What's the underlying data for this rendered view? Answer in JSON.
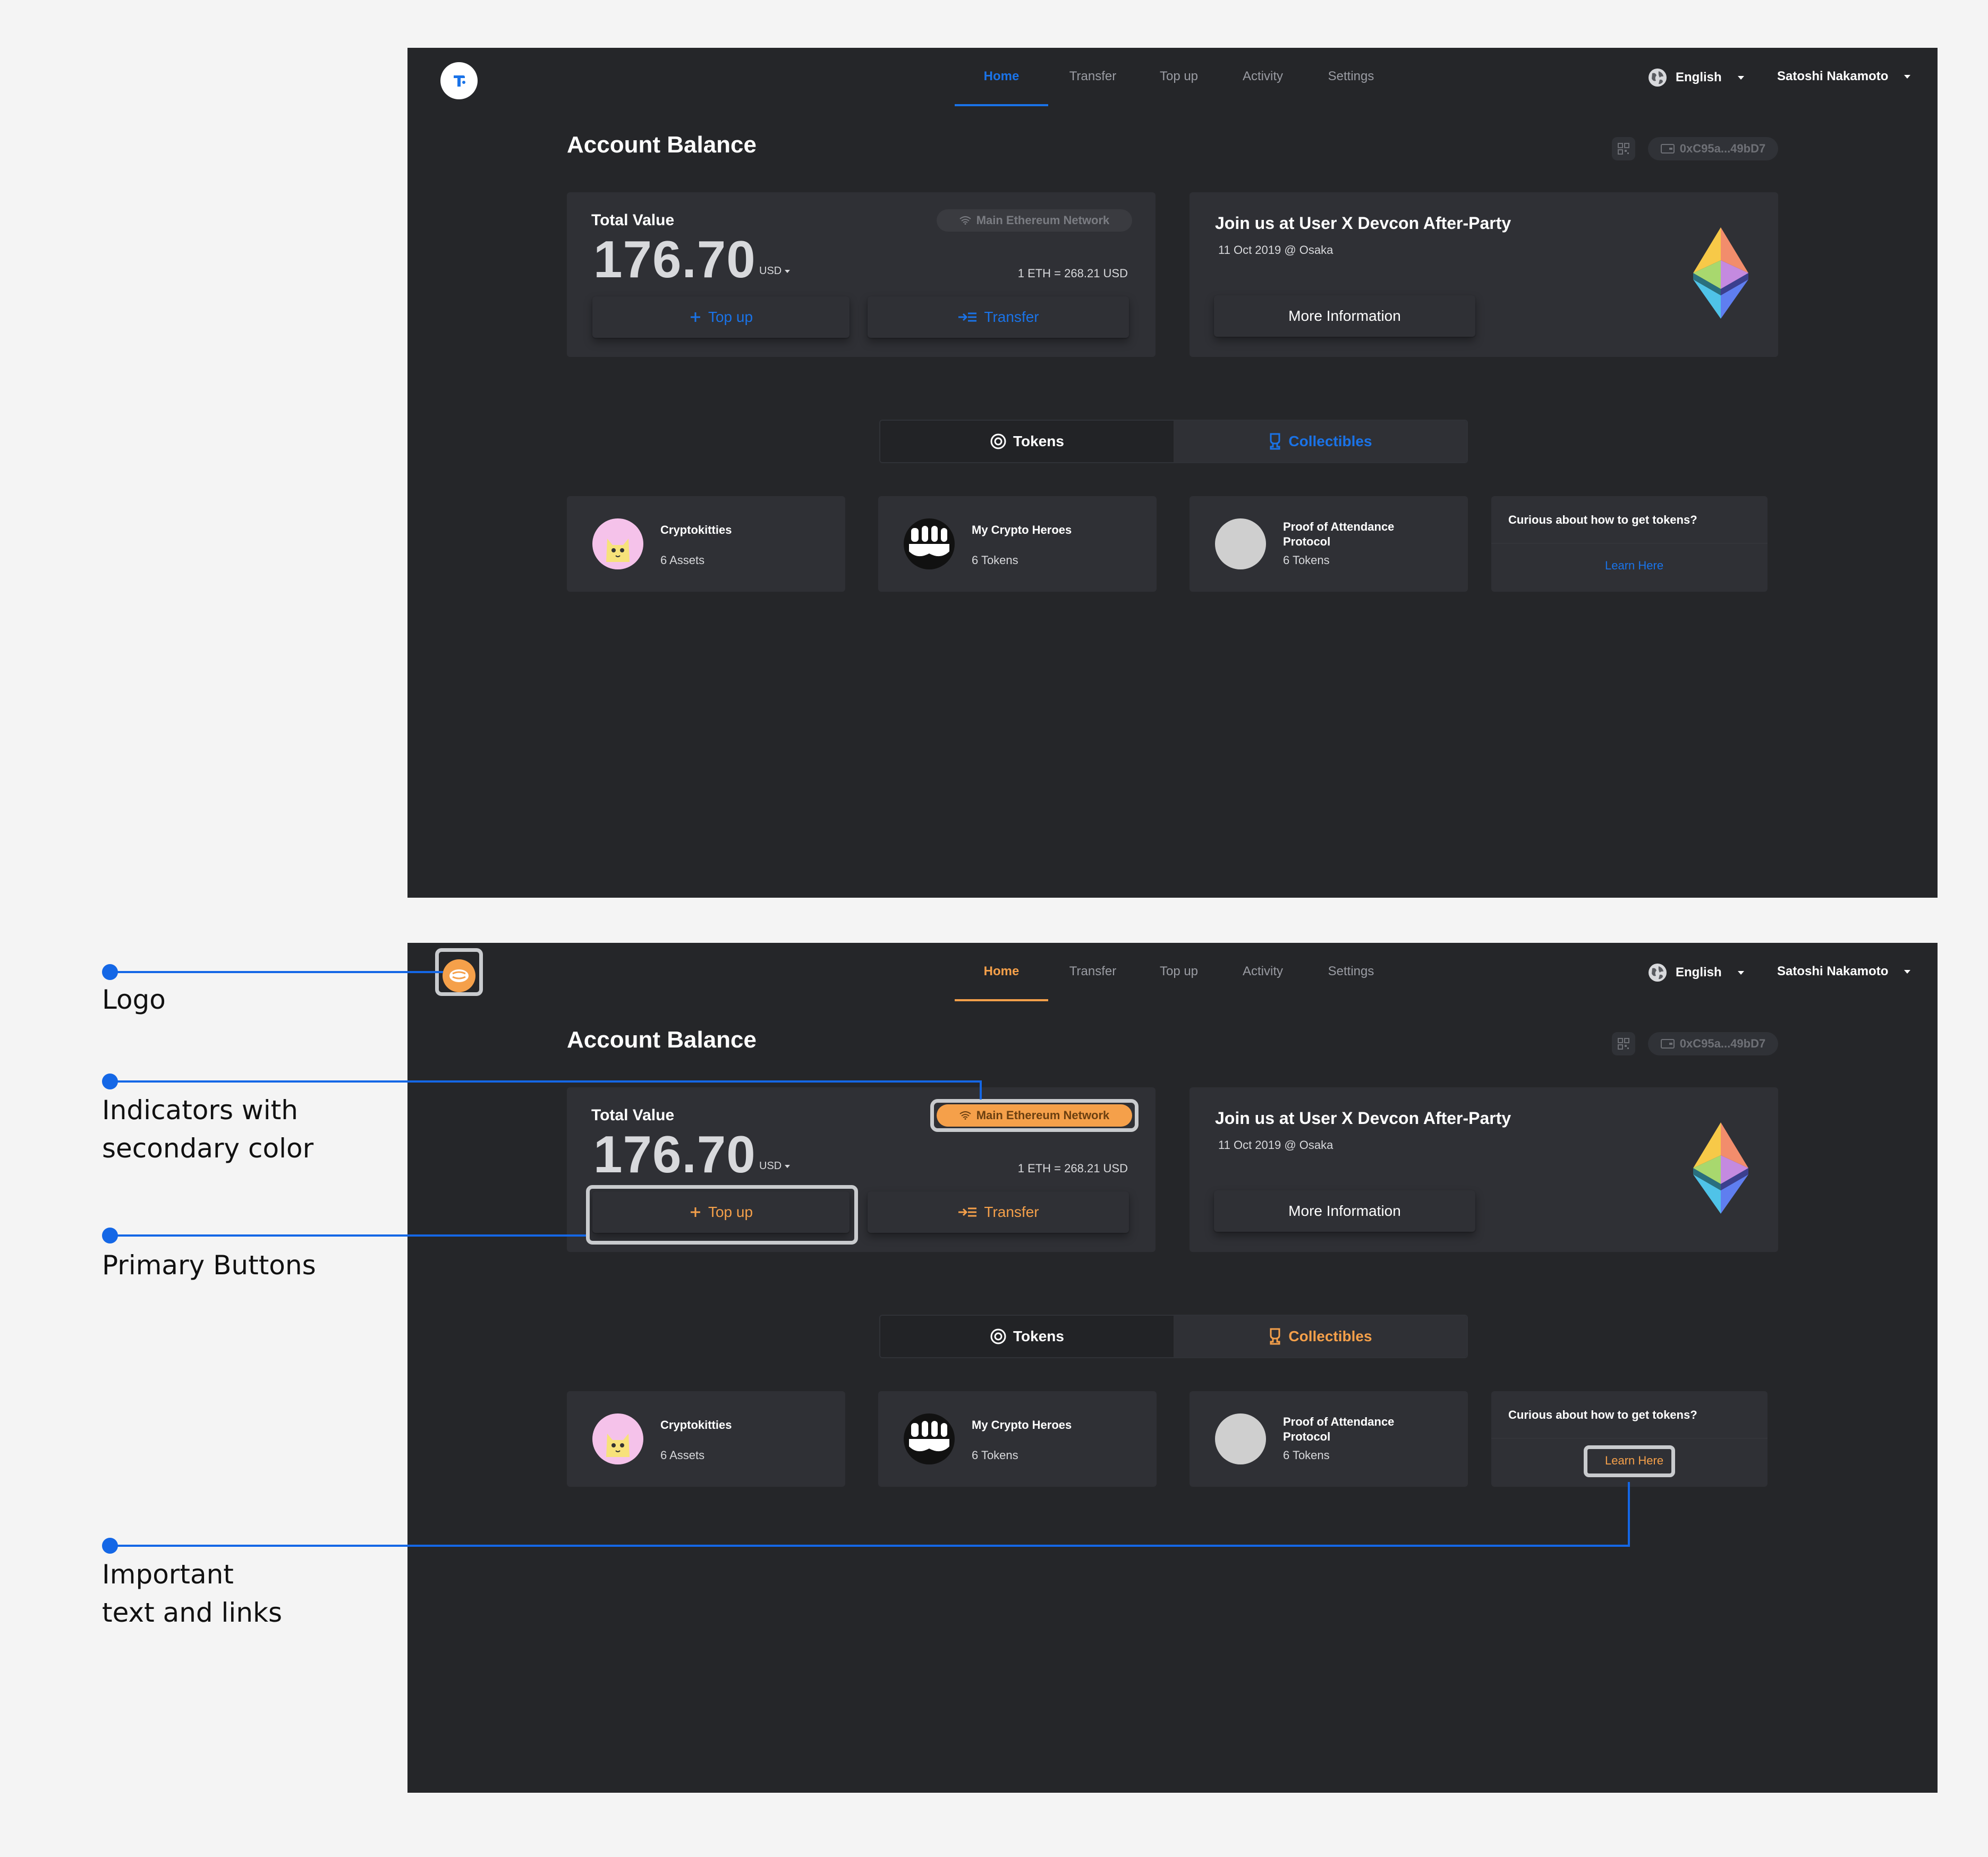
{
  "screens": [
    {
      "theme": "blue",
      "accent": "#1a73e8",
      "nav": {
        "tabs": [
          "Home",
          "Transfer",
          "Top up",
          "Activity",
          "Settings"
        ],
        "active_tab": "Home",
        "language": "English",
        "user": "Satoshi Nakamoto"
      },
      "page_title": "Account Balance",
      "wallet_address": "0xC95a...49bD7",
      "balance": {
        "label": "Total Value",
        "amount": "176.70",
        "currency": "USD",
        "network": "Main Ethereum Network",
        "rate": "1 ETH = 268.21 USD",
        "topup_label": "Top up",
        "transfer_label": "Transfer"
      },
      "event": {
        "title": "Join us at User X Devcon After-Party",
        "subtitle": "11 Oct 2019 @ Osaka",
        "button": "More Information"
      },
      "segment": {
        "tokens": "Tokens",
        "collectibles": "Collectibles"
      },
      "collectibles": [
        {
          "name": "Cryptokitties",
          "count": "6 Assets",
          "icon": "cryptokitties-avatar"
        },
        {
          "name": "My Crypto Heroes",
          "count": "6 Tokens",
          "icon": "crypto-heroes-avatar"
        },
        {
          "name": "Proof of Attendance Protocol",
          "count": "6 Tokens",
          "icon": "placeholder-avatar"
        }
      ],
      "help": {
        "question": "Curious about how to get tokens?",
        "link": "Learn Here"
      }
    },
    {
      "theme": "orange",
      "accent": "#f5a04a",
      "nav": {
        "tabs": [
          "Home",
          "Transfer",
          "Top up",
          "Activity",
          "Settings"
        ],
        "active_tab": "Home",
        "language": "English",
        "user": "Satoshi Nakamoto"
      },
      "page_title": "Account Balance",
      "wallet_address": "0xC95a...49bD7",
      "balance": {
        "label": "Total Value",
        "amount": "176.70",
        "currency": "USD",
        "network": "Main Ethereum Network",
        "rate": "1 ETH = 268.21 USD",
        "topup_label": "Top up",
        "transfer_label": "Transfer"
      },
      "event": {
        "title": "Join us at User X Devcon After-Party",
        "subtitle": "11 Oct 2019 @ Osaka",
        "button": "More Information"
      },
      "segment": {
        "tokens": "Tokens",
        "collectibles": "Collectibles"
      },
      "collectibles": [
        {
          "name": "Cryptokitties",
          "count": "6 Assets",
          "icon": "cryptokitties-avatar"
        },
        {
          "name": "My Crypto Heroes",
          "count": "6 Tokens",
          "icon": "crypto-heroes-avatar"
        },
        {
          "name": "Proof of Attendance Protocol",
          "count": "6 Tokens",
          "icon": "placeholder-avatar"
        }
      ],
      "help": {
        "question": "Curious about how to get tokens?",
        "link": "Learn Here"
      }
    }
  ],
  "annotations": {
    "color": "#1467e6",
    "logo": "Logo",
    "indicators_line1": "Indicators with",
    "indicators_line2": "secondary color",
    "primary_buttons": "Primary Buttons",
    "important_line1": "Important",
    "important_line2": "text and links"
  }
}
